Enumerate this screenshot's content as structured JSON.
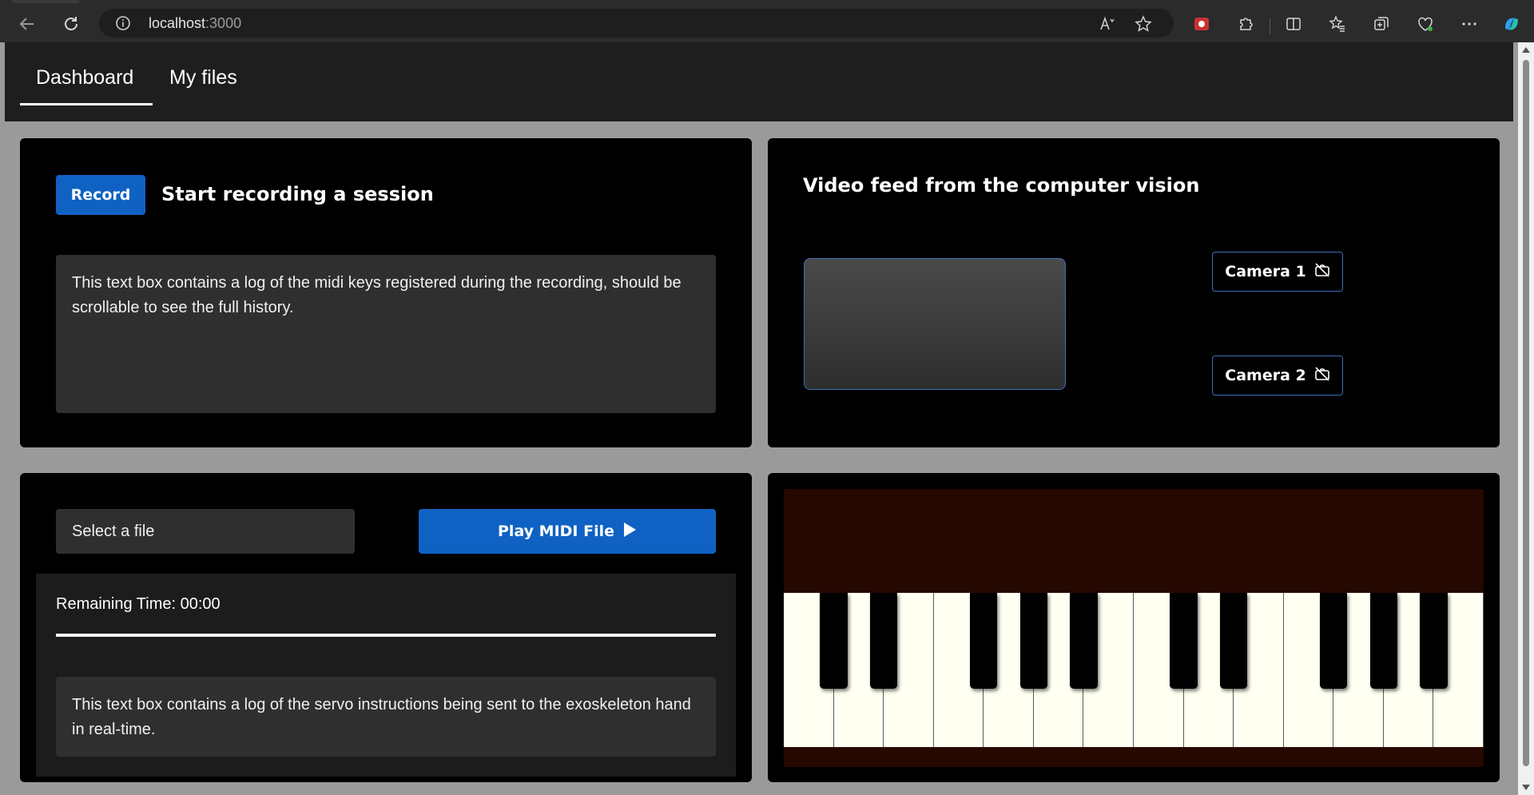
{
  "browser": {
    "url_host": "localhost",
    "url_port": ":3000",
    "icons": [
      "back-icon",
      "refresh-icon",
      "info-icon",
      "read-aloud-icon",
      "favorite-star-icon",
      "extension-red-icon",
      "extensions-icon",
      "split-screen-icon",
      "favorites-icon",
      "collections-icon",
      "browser-essentials-icon",
      "more-icon",
      "copilot-icon"
    ]
  },
  "nav": {
    "tabs": [
      {
        "label": "Dashboard",
        "active": true
      },
      {
        "label": "My files",
        "active": false
      }
    ]
  },
  "recording": {
    "button_label": "Record",
    "title": "Start recording a session",
    "log_text": "This text box contains a log of the midi keys registered during the recording, should be scrollable to see the full history."
  },
  "video": {
    "title": "Video feed from the computer vision",
    "cameras": [
      {
        "label": "Camera 1",
        "icon": "camera-off-icon"
      },
      {
        "label": "Camera 2",
        "icon": "camera-off-icon"
      }
    ]
  },
  "playback": {
    "select_placeholder": "Select a file",
    "play_button_label": "Play MIDI File",
    "remaining_time": "Remaining Time: 00:00",
    "progress": 1.0,
    "log_text": "This text box contains a log of the servo instructions being sent to the exoskeleton hand in real-time."
  },
  "piano": {
    "white_key_count": 14,
    "black_key_after_white": [
      0,
      1,
      3,
      4,
      5,
      7,
      8,
      10,
      11,
      12
    ],
    "colors": {
      "background": "#250800",
      "white_key": "#fffff2",
      "black_key": "#000000"
    }
  },
  "colors": {
    "accent": "#0f62c3",
    "card": "#000000",
    "page": "#9a9a9a",
    "appbar": "#1e1e1e",
    "input": "#2f2f2f"
  }
}
